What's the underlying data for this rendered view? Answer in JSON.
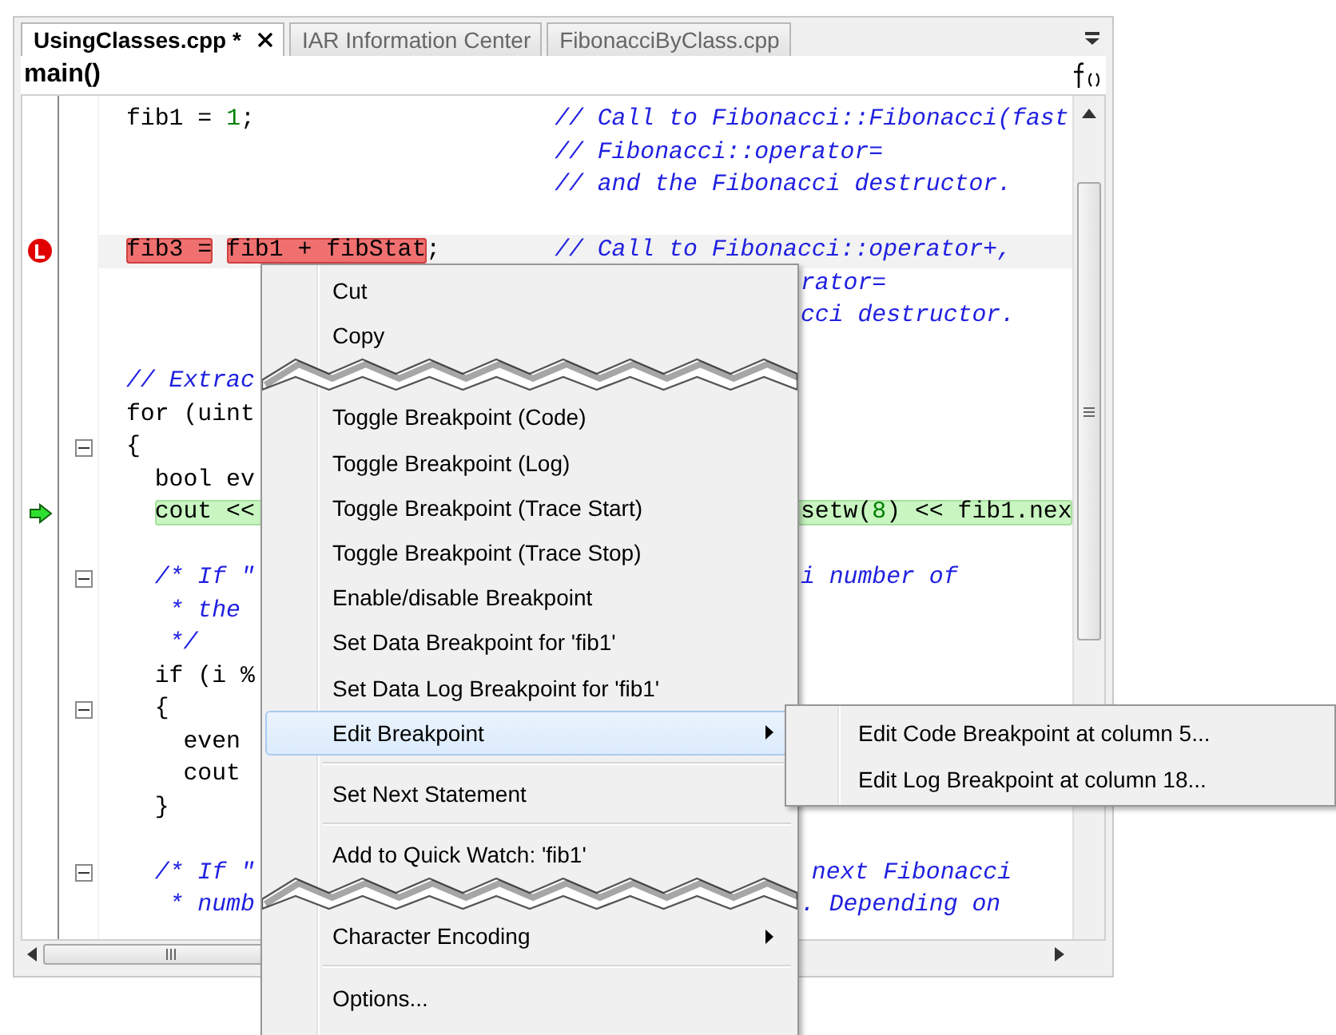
{
  "tabs": [
    {
      "label": "UsingClasses.cpp *",
      "selected": true,
      "closable": true
    },
    {
      "label": "IAR Information Center",
      "selected": false,
      "closable": false
    },
    {
      "label": "FibonacciByClass.cpp",
      "selected": false,
      "closable": false
    }
  ],
  "function_bar": {
    "label": "main()"
  },
  "code_lines": [
    {
      "breakpoint": false,
      "current": false,
      "fold": false,
      "left": [
        {
          "kind": "code",
          "text": "fib1 = "
        },
        {
          "kind": "number",
          "text": "1"
        },
        {
          "kind": "code",
          "text": ";"
        }
      ],
      "right": {
        "kind": "comment_column",
        "segments": [
          {
            "kind": "comment",
            "text": "// Call to Fibonacci::Fibonacci(fast"
          }
        ]
      }
    },
    {
      "breakpoint": false,
      "current": false,
      "fold": false,
      "right": {
        "kind": "comment_column",
        "segments": [
          {
            "kind": "comment",
            "text": "// Fibonacci::operator="
          }
        ]
      }
    },
    {
      "breakpoint": false,
      "current": false,
      "fold": false,
      "right": {
        "kind": "comment_column",
        "segments": [
          {
            "kind": "comment",
            "text": "// and the Fibonacci destructor."
          }
        ]
      }
    },
    {
      "breakpoint": false,
      "current": false,
      "fold": false
    },
    {
      "breakpoint": true,
      "current": false,
      "fold": false,
      "left": [
        {
          "kind": "bp",
          "text": "fib3 ="
        },
        {
          "kind": "bp",
          "text": "fib1 + fibStat"
        },
        {
          "kind": "code",
          "text": ";"
        }
      ],
      "right": {
        "kind": "comment_column",
        "segments": [
          {
            "kind": "comment",
            "text": "// Call to Fibonacci::operator+,"
          }
        ]
      }
    },
    {
      "breakpoint": false,
      "current": false,
      "fold": false,
      "right": {
        "kind": "after_menu",
        "segments": [
          {
            "kind": "comment",
            "text": "rator="
          }
        ]
      }
    },
    {
      "breakpoint": false,
      "current": false,
      "fold": false,
      "right": {
        "kind": "after_menu",
        "segments": [
          {
            "kind": "comment",
            "text": "cci destructor."
          }
        ]
      }
    },
    {
      "breakpoint": false,
      "current": false,
      "fold": false
    },
    {
      "breakpoint": false,
      "current": false,
      "fold": false,
      "left": [
        {
          "kind": "comment",
          "text": "// Extrac"
        }
      ]
    },
    {
      "breakpoint": false,
      "current": false,
      "fold": false,
      "left": [
        {
          "kind": "code",
          "text": "for (uint"
        }
      ]
    },
    {
      "breakpoint": false,
      "current": false,
      "fold": true,
      "left": [
        {
          "kind": "code",
          "text": "{"
        }
      ]
    },
    {
      "breakpoint": false,
      "current": false,
      "fold": false,
      "left": [
        {
          "kind": "code",
          "text": "  bool ev"
        }
      ]
    },
    {
      "breakpoint": false,
      "current": true,
      "fold": false,
      "left": [
        {
          "kind": "code",
          "text": "cout <<"
        }
      ],
      "right": {
        "kind": "after_menu",
        "segments": [
          {
            "kind": "code",
            "text": "setw("
          },
          {
            "kind": "number",
            "text": "8"
          },
          {
            "kind": "code",
            "text": ") << fib1.nex"
          }
        ]
      }
    },
    {
      "breakpoint": false,
      "current": false,
      "fold": false
    },
    {
      "breakpoint": false,
      "current": false,
      "fold": true,
      "left": [
        {
          "kind": "comment",
          "text": "  /* If \""
        }
      ],
      "right": {
        "kind": "after_menu",
        "segments": [
          {
            "kind": "comment",
            "text": "i number of"
          }
        ]
      }
    },
    {
      "breakpoint": false,
      "current": false,
      "fold": false,
      "left": [
        {
          "kind": "comment",
          "text": "   * the"
        }
      ]
    },
    {
      "breakpoint": false,
      "current": false,
      "fold": false,
      "left": [
        {
          "kind": "comment",
          "text": "   */"
        }
      ]
    },
    {
      "breakpoint": false,
      "current": false,
      "fold": false,
      "left": [
        {
          "kind": "code",
          "text": "  if (i %"
        }
      ]
    },
    {
      "breakpoint": false,
      "current": false,
      "fold": true,
      "left": [
        {
          "kind": "code",
          "text": "  {"
        }
      ]
    },
    {
      "breakpoint": false,
      "current": false,
      "fold": false,
      "left": [
        {
          "kind": "code",
          "text": "    even"
        }
      ]
    },
    {
      "breakpoint": false,
      "current": false,
      "fold": false,
      "left": [
        {
          "kind": "code",
          "text": "    cout"
        }
      ]
    },
    {
      "breakpoint": false,
      "current": false,
      "fold": false,
      "left": [
        {
          "kind": "code",
          "text": "  }"
        }
      ]
    },
    {
      "breakpoint": false,
      "current": false,
      "fold": false
    },
    {
      "breakpoint": false,
      "current": false,
      "fold": true,
      "left": [
        {
          "kind": "comment",
          "text": "  /* If \""
        }
      ],
      "right": {
        "kind": "after_menu_wide",
        "segments": [
          {
            "kind": "comment",
            "text": "next Fibonacci"
          }
        ]
      }
    },
    {
      "breakpoint": false,
      "current": false,
      "fold": false,
      "left": [
        {
          "kind": "comment",
          "text": "   * numb"
        }
      ],
      "right": {
        "kind": "after_menu",
        "segments": [
          {
            "kind": "comment",
            "text": ". Depending on"
          }
        ]
      }
    }
  ],
  "context_menu": {
    "items": [
      {
        "kind": "item",
        "label": "Cut",
        "selected": false,
        "submenu": false
      },
      {
        "kind": "item",
        "label": "Copy",
        "selected": false,
        "submenu": false
      },
      {
        "kind": "tear"
      },
      {
        "kind": "item",
        "label": "Toggle Breakpoint (Code)",
        "selected": false,
        "submenu": false
      },
      {
        "kind": "item",
        "label": "Toggle Breakpoint (Log)",
        "selected": false,
        "submenu": false
      },
      {
        "kind": "item",
        "label": "Toggle Breakpoint (Trace Start)",
        "selected": false,
        "submenu": false
      },
      {
        "kind": "item",
        "label": "Toggle Breakpoint (Trace Stop)",
        "selected": false,
        "submenu": false
      },
      {
        "kind": "item",
        "label": "Enable/disable Breakpoint",
        "selected": false,
        "submenu": false
      },
      {
        "kind": "item",
        "label": "Set Data Breakpoint for 'fib1'",
        "selected": false,
        "submenu": false
      },
      {
        "kind": "item",
        "label": "Set Data Log Breakpoint for 'fib1'",
        "selected": false,
        "submenu": false
      },
      {
        "kind": "item",
        "label": "Edit Breakpoint",
        "selected": true,
        "submenu": true
      },
      {
        "kind": "separator"
      },
      {
        "kind": "item",
        "label": "Set Next Statement",
        "selected": false,
        "submenu": false
      },
      {
        "kind": "separator"
      },
      {
        "kind": "item",
        "label": "Add to Quick Watch:  'fib1'",
        "selected": false,
        "submenu": false
      },
      {
        "kind": "tear"
      },
      {
        "kind": "item",
        "label": "Character Encoding",
        "selected": false,
        "submenu": true
      },
      {
        "kind": "separator"
      },
      {
        "kind": "item",
        "label": "Options...",
        "selected": false,
        "submenu": false
      }
    ]
  },
  "submenu": {
    "items": [
      {
        "label": "Edit Code Breakpoint at column 5..."
      },
      {
        "label": "Edit Log Breakpoint at column 18..."
      }
    ]
  }
}
